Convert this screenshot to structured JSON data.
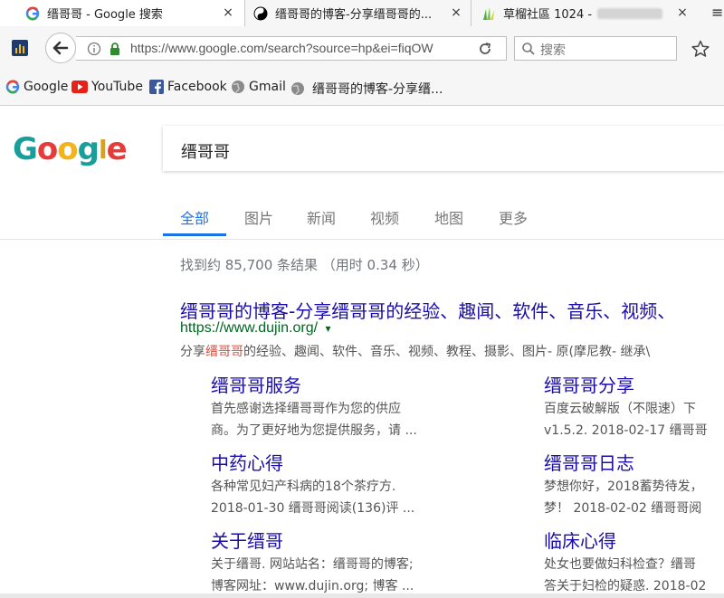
{
  "tabs": [
    {
      "title": "缙哥哥 - Google 搜索",
      "close": "×"
    },
    {
      "title": "缙哥哥的博客-分享缙哥哥的...",
      "close": "×"
    },
    {
      "title": "草榴社區 1024 -",
      "close": "×"
    }
  ],
  "navbar": {
    "url": "https://www.google.com/search?source=hp&ei=fiqOW",
    "search_placeholder": "搜索"
  },
  "bookmarks": [
    "Google",
    "YouTube",
    "Facebook",
    "Gmail",
    "缙哥哥的博客-分享缙..."
  ],
  "google": {
    "logo_letters": [
      "G",
      "o",
      "o",
      "g",
      "l",
      "e"
    ],
    "query": "缙哥哥",
    "nav": [
      "全部",
      "图片",
      "新闻",
      "视频",
      "地图",
      "更多"
    ]
  },
  "results": {
    "stats": "找到约 85,700 条结果  （用时 0.34 秒）",
    "main": {
      "title": "缙哥哥的博客-分享缙哥哥的经验、趣闻、软件、音乐、视频、",
      "url": "https://www.dujin.org/",
      "url_arrow": "▾",
      "snippet_pre": "分享",
      "snippet_hl": "缙哥哥",
      "snippet_post": "的经验、趣闻、软件、音乐、视频、教程、摄影、图片- 原(摩尼教- 继承\\"
    },
    "sitelinks": [
      {
        "title": "缙哥哥服务",
        "line1": "首先感谢选择缙哥哥作为您的供应",
        "line2": "商。为了更好地为您提供服务，请 ..."
      },
      {
        "title": "缙哥哥分享",
        "line1": "百度云破解版（不限速）下",
        "line2": "v1.5.2. 2018-02-17 缙哥哥"
      },
      {
        "title": "中药心得",
        "line1": "各种常见妇产科病的18个茶疗方.",
        "line2": "2018-01-30 缙哥哥阅读(136)评 ..."
      },
      {
        "title": "缙哥哥日志",
        "line1": "梦想你好，2018蓄势待发，",
        "line2": "梦！ 2018-02-02 缙哥哥阅"
      },
      {
        "title": "关于缙哥",
        "line1": "关于缙哥. 网站站名：缙哥哥的博客;",
        "line2": "博客网址：www.dujin.org; 博客 ..."
      },
      {
        "title": "临床心得",
        "line1": "处女也要做妇科检查？缙哥",
        "line2": "答关于妇检的疑惑. 2018-02"
      }
    ]
  }
}
